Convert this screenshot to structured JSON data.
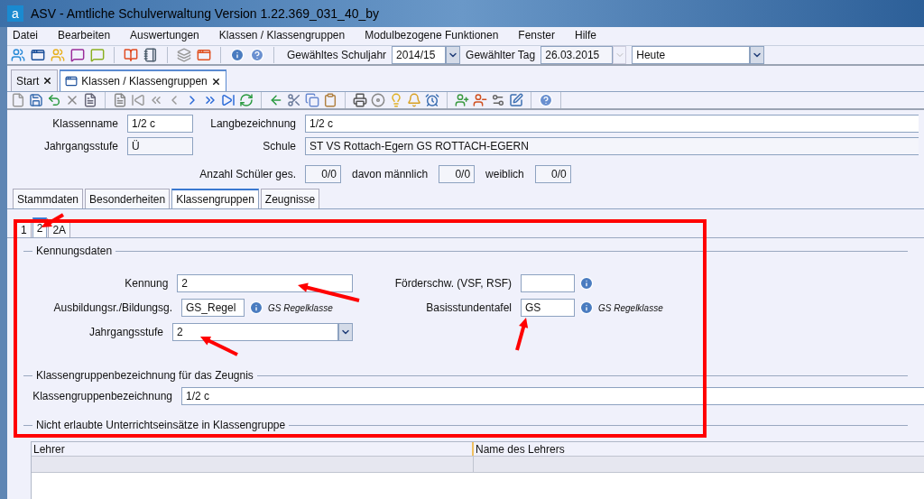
{
  "window": {
    "logo": "a",
    "title": "ASV - Amtliche Schulverwaltung Version 1.22.369_031_40_by"
  },
  "menu": [
    "Datei",
    "Bearbeiten",
    "Auswertungen",
    "Klassen / Klassengruppen",
    "Modulbezogene Funktionen",
    "Fenster",
    "Hilfe"
  ],
  "toolbar": {
    "schuljahr_label": "Gewähltes Schuljahr",
    "schuljahr": "2014/15",
    "tag_label": "Gewählter Tag",
    "tag": "26.03.2015",
    "mode": "Heute"
  },
  "doc_tabs": [
    {
      "label": "Start",
      "selected": false
    },
    {
      "label": "Klassen / Klassengruppen",
      "selected": true
    }
  ],
  "header": {
    "klassenname_label": "Klassenname",
    "klassenname": "1/2 c",
    "langbezeichnung_label": "Langbezeichnung",
    "langbezeichnung": "1/2 c",
    "jahrgangsstufe_label": "Jahrgangsstufe",
    "jahrgangsstufe": "Ü",
    "schule_label": "Schule",
    "schule": "ST VS Rottach-Egern GS ROTTACH-EGERN",
    "anzahl_label": "Anzahl Schüler ges.",
    "anzahl": "0/0",
    "maennlich_label": "davon männlich",
    "maennlich": "0/0",
    "weiblich_label": "weiblich",
    "weiblich": "0/0"
  },
  "tabs": [
    {
      "label": "Stammdaten",
      "selected": false
    },
    {
      "label": "Besonderheiten",
      "selected": false
    },
    {
      "label": "Klassengruppen",
      "selected": true
    },
    {
      "label": "Zeugnisse",
      "selected": false
    }
  ],
  "subtabs": [
    {
      "label": "1",
      "selected": false
    },
    {
      "label": "2",
      "selected": true
    },
    {
      "label": "2A",
      "selected": false
    }
  ],
  "kennungsdaten": {
    "legend": "Kennungsdaten",
    "kennung_label": "Kennung",
    "kennung": "2",
    "ausbildung_label": "Ausbildungsr./Bildungsg.",
    "ausbildung": "GS_Regel",
    "ausbildung_hint": "GS Regelklasse",
    "jahrgangsstufe_label": "Jahrgangsstufe",
    "jahrgangsstufe": "2",
    "foerder_label": "Förderschw. (VSF, RSF)",
    "basis_label": "Basisstundentafel",
    "basis": "GS",
    "basis_hint": "GS Regelklasse"
  },
  "zeugnis": {
    "legend": "Klassengruppenbezeichnung für das Zeugnis",
    "label": "Klassengruppenbezeichnung",
    "value": "1/2 c"
  },
  "einsaetze": {
    "legend": "Nicht erlaubte Unterrichtseinsätze in Klassengruppe",
    "columns": [
      "Lehrer",
      "Name des Lehrers"
    ]
  }
}
